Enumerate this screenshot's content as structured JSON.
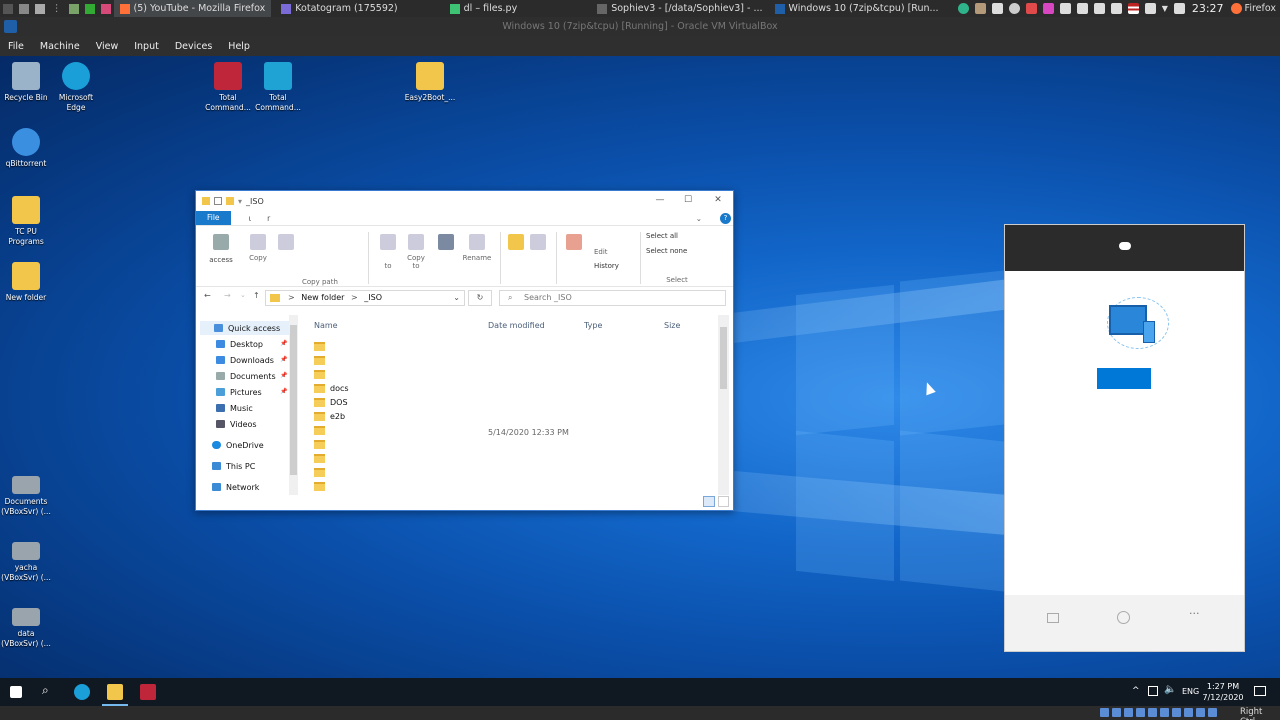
{
  "host": {
    "tasks": [
      {
        "label": "(5) YouTube - Mozilla Firefox",
        "active": true
      },
      {
        "label": "Kotatogram (175592)",
        "active": false
      },
      {
        "label": "dl – files.py",
        "active": false
      },
      {
        "label": "Sophiev3 - [/data/Sophiev3] - ...",
        "active": false
      },
      {
        "label": "Windows 10 (7zip&tcpu) [Run...",
        "active": false
      }
    ],
    "clock": "23:27",
    "browser_label": "Firefox"
  },
  "vbox": {
    "title": "Windows 10 (7zip&tcpu) [Running] - Oracle VM VirtualBox",
    "menu": [
      "File",
      "Machine",
      "View",
      "Input",
      "Devices",
      "Help"
    ],
    "host_key": "Right Ctrl"
  },
  "desktop_icons": [
    {
      "label": "Recycle Bin",
      "color": "#9ab3c9"
    },
    {
      "label": "Microsoft Edge",
      "color": "#1a9fd8"
    },
    {
      "label": "Total Command...",
      "color": "#c0263a"
    },
    {
      "label": "Total Command...",
      "color": "#1fa3d4"
    },
    {
      "label": "Easy2Boot_...",
      "color": "#f2c64a"
    },
    {
      "label": "qBittorrent",
      "color": "#3b8fe0"
    },
    {
      "label": "TC PU Programs",
      "color": "#f2c64a"
    },
    {
      "label": "New folder",
      "color": "#f2c64a"
    },
    {
      "label": "Documents (VBoxSvr) (...",
      "color": "#9aa4ad"
    },
    {
      "label": "yacha (VBoxSvr) (...",
      "color": "#9aa4ad"
    },
    {
      "label": "data (VBoxSvr) (...",
      "color": "#9aa4ad"
    }
  ],
  "explorer": {
    "title": "_ISO",
    "tabs": {
      "file": "File",
      "home": "ι",
      "share": "r"
    },
    "ribbon": {
      "pin_label": "access",
      "copy": "Copy",
      "copy_path": "Copy path",
      "move_to": "to",
      "copy_to": "Copy to",
      "rename": "Rename",
      "edit": "Edit",
      "history": "History",
      "select_all": "Select all",
      "select_none": "Select none",
      "select_group": "Select"
    },
    "breadcrumb": {
      "parent": "New folder",
      "sep": ">",
      "current": "_ISO"
    },
    "search_placeholder": "Search _ISO",
    "nav": {
      "quick_access": "Quick access",
      "items": [
        "Desktop",
        "Downloads",
        "Documents",
        "Pictures",
        "Music",
        "Videos"
      ],
      "onedrive": "OneDrive",
      "this_pc": "This PC",
      "network": "Network"
    },
    "columns": {
      "name": "Name",
      "date": "Date modified",
      "type": "Type",
      "size": "Size"
    },
    "files": [
      "",
      "",
      "",
      "docs",
      "DOS",
      "e2b",
      "",
      "",
      "",
      "",
      "",
      ""
    ],
    "date_value": "5/14/2020 12:33 PM"
  },
  "taskbar": {
    "lang": "ENG",
    "time": "1:27 PM",
    "date": "7/12/2020"
  },
  "colors": {
    "accent": "#1979ca",
    "desktop": "#0a4ea8"
  }
}
